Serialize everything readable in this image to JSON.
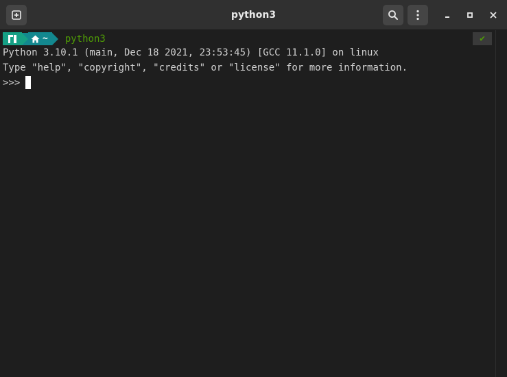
{
  "window": {
    "title": "python3"
  },
  "icons": {
    "new_tab": "new-tab-icon",
    "search": "search-icon",
    "menu": "kebab-menu-icon",
    "minimize": "minimize-icon",
    "maximize": "maximize-icon",
    "close": "close-icon",
    "distro_logo": "manjaro-logo-icon",
    "home": "home-icon"
  },
  "prompt": {
    "home_dir": "~",
    "command": "python3",
    "status": "✔"
  },
  "output": {
    "line1": "Python 3.10.1 (main, Dec 18 2021, 23:53:45) [GCC 11.1.0] on linux",
    "line2": "Type \"help\", \"copyright\", \"credits\" or \"license\" for more information.",
    "repl_prompt": ">>>"
  },
  "colors": {
    "logo_segment": "#16a085",
    "home_segment": "#13888f",
    "command_green": "#4e9a06",
    "background": "#1e1e1e",
    "titlebar": "#303030"
  }
}
